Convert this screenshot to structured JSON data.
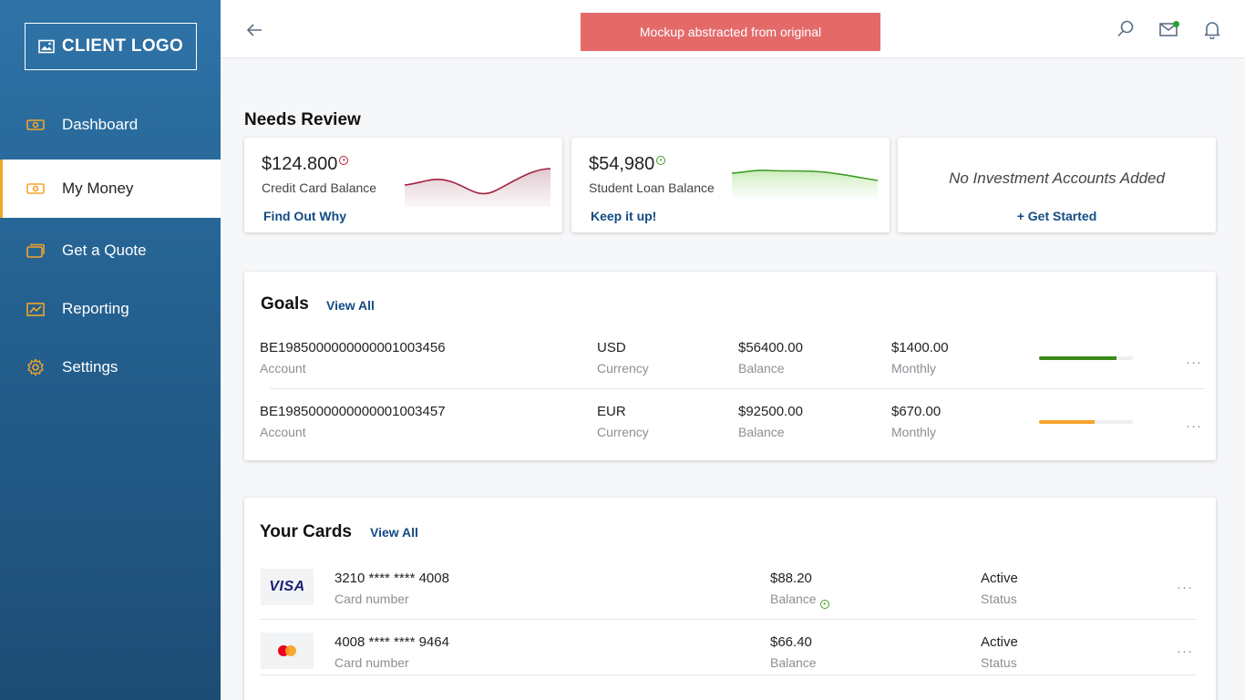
{
  "app": {
    "logo_label": "CLIENT LOGO"
  },
  "sidebar": {
    "items": [
      {
        "label": "Dashboard",
        "icon": "money-icon"
      },
      {
        "label": "My Money",
        "icon": "money-icon",
        "active": true
      },
      {
        "label": "Get a Quote",
        "icon": "cards-icon"
      },
      {
        "label": "Reporting",
        "icon": "chart-icon"
      },
      {
        "label": "Settings",
        "icon": "gear-icon"
      }
    ]
  },
  "topbar": {
    "banner_text": "Mockup abstracted from original",
    "icons": [
      "back-arrow-icon",
      "search-icon",
      "mail-icon",
      "bell-icon"
    ]
  },
  "needs_review": {
    "title": "Needs Review",
    "cards": [
      {
        "amount": "$124.800",
        "label": "Credit Card Balance",
        "cta": "Find Out Why",
        "trend": "negative"
      },
      {
        "amount": "$54,980",
        "label": "Student Loan Balance",
        "cta": "Keep it up!",
        "trend": "positive"
      },
      {
        "empty_text": "No Investment Accounts Added",
        "cta": "Get Started"
      }
    ]
  },
  "goals": {
    "title": "Goals",
    "view_all": "View All",
    "rows": [
      {
        "account": "BE1985000000000001003456",
        "account_label": "Account",
        "currency": "USD",
        "currency_label": "Currency",
        "balance": "$56400.00",
        "balance_label": "Balance",
        "monthly": "$1400.00",
        "monthly_label": "Monthly",
        "progress": 0.83,
        "progress_color": "#3a8a18"
      },
      {
        "account": "BE1985000000000001003457",
        "account_label": "Account",
        "currency": "EUR",
        "currency_label": "Currency",
        "balance": "$92500.00",
        "balance_label": "Balance",
        "monthly": "$670.00",
        "monthly_label": "Monthly",
        "progress": 0.59,
        "progress_color": "#f4a52a"
      }
    ],
    "menu": "···"
  },
  "cards": {
    "title": "Your Cards",
    "view_all": "View All",
    "rows": [
      {
        "brand": "VISA",
        "number": "3210 **** **** 4008",
        "number_label": "Card number",
        "balance": "$88.20",
        "balance_label": "Balance",
        "status": "Active",
        "status_label": "Status"
      },
      {
        "brand": "mastercard",
        "number": "4008 **** **** 9464",
        "number_label": "Card number",
        "balance": "$66.40",
        "balance_label": "Balance",
        "status": "Active",
        "status_label": "Status"
      }
    ],
    "menu": "···"
  },
  "colors": {
    "accent": "#f4a52a",
    "link": "#124b83",
    "positive": "#3d9e25",
    "negative": "#b0203c",
    "banner": "#e46a6a"
  }
}
